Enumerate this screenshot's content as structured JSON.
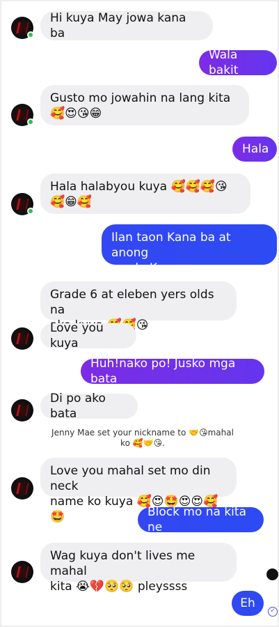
{
  "messages": {
    "m1": "Hi kuya May jowa kana ba",
    "m2": "Wala bakit",
    "m3": "Gusto mo jowahin na lang kita 🥰😍😘😁",
    "m4": "Hala",
    "m5_line1": "Hala halabyou kuya 🥰🥰🥰😘",
    "m5_line2": "🥰😁🥰",
    "m6_line1": "Ilan taon Kana ba at anong",
    "m6_line2": "grade Kana",
    "m7_line1": "Grade 6 at eleben yers olds na",
    "m7_line2": "ako kuya 🥰🥰😘",
    "m8": "Love you kuya",
    "m9": "Huh!nako po! Jusko mga bata",
    "m10": "Di po ako bata",
    "system_line1": "Jenny Mae set your nickname to 🤝😘mahal",
    "system_line2": "ko 🥰🤝😘.",
    "m11_line1": "Love you mahal set mo din neck",
    "m11_line2": "name ko kuya 🥰😍🤩😍😍🥰🤩",
    "m12": "Block mo na kita ne",
    "m13_line1": "Wag kuya don't lives me mahal",
    "m13_line2": "kita 😭💔🥺🥺 pleyssss",
    "m14": "Eh"
  },
  "seen_icon": "check-circle-icon",
  "avatar_icon": "profile-picture",
  "colors": {
    "incoming_bubble": "#efeff1",
    "outgoing_violet": "#7c2ce6",
    "outgoing_blue": "#3347f3",
    "online_dot": "#2bc24a"
  }
}
